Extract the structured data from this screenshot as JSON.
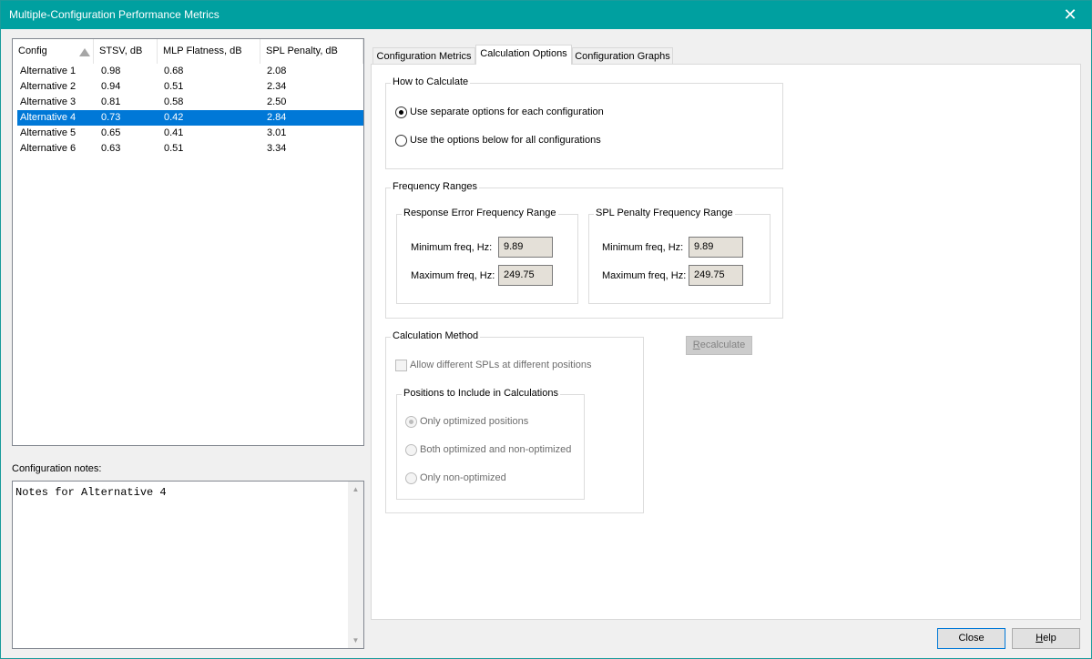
{
  "window": {
    "title": "Multiple-Configuration Performance Metrics",
    "close_glyph": "✕"
  },
  "config_list": {
    "columns": [
      "Config",
      "STSV, dB",
      "MLP Flatness, dB",
      "SPL Penalty, dB"
    ],
    "sort_column": "Config",
    "rows": [
      {
        "config": "Alternative 1",
        "stsv": "0.98",
        "mlp": "0.68",
        "spl": "2.08",
        "selected": false
      },
      {
        "config": "Alternative 2",
        "stsv": "0.94",
        "mlp": "0.51",
        "spl": "2.34",
        "selected": false
      },
      {
        "config": "Alternative 3",
        "stsv": "0.81",
        "mlp": "0.58",
        "spl": "2.50",
        "selected": false
      },
      {
        "config": "Alternative 4",
        "stsv": "0.73",
        "mlp": "0.42",
        "spl": "2.84",
        "selected": true
      },
      {
        "config": "Alternative 5",
        "stsv": "0.65",
        "mlp": "0.41",
        "spl": "3.01",
        "selected": false
      },
      {
        "config": "Alternative 6",
        "stsv": "0.63",
        "mlp": "0.51",
        "spl": "3.34",
        "selected": false
      }
    ]
  },
  "notes": {
    "label": "Configuration notes:",
    "value": "Notes for Alternative 4"
  },
  "tabs": [
    {
      "label": "Configuration Metrics",
      "active": false
    },
    {
      "label": "Calculation Options",
      "active": true
    },
    {
      "label": "Configuration Graphs",
      "active": false
    }
  ],
  "how_to_calculate": {
    "label": "How to Calculate",
    "options": [
      {
        "label": "Use separate options for each configuration",
        "checked": true
      },
      {
        "label": "Use the options below for all configurations",
        "checked": false
      }
    ]
  },
  "frequency_ranges": {
    "label": "Frequency Ranges",
    "response_error": {
      "label": "Response Error Frequency Range",
      "min_label": "Minimum freq, Hz:",
      "min_value": "9.89",
      "max_label": "Maximum freq, Hz:",
      "max_value": "249.75"
    },
    "spl_penalty": {
      "label": "SPL Penalty Frequency Range",
      "min_label": "Minimum freq, Hz:",
      "min_value": "9.89",
      "max_label": "Maximum freq, Hz:",
      "max_value": "249.75"
    }
  },
  "calculation_method": {
    "label": "Calculation Method",
    "allow_different_spls": {
      "label": "Allow different SPLs at different positions",
      "checked": false,
      "enabled": false
    },
    "positions": {
      "label": "Positions to Include in Calculations",
      "options": [
        {
          "label": "Only optimized positions",
          "checked": true
        },
        {
          "label": "Both optimized and non-optimized",
          "checked": false
        },
        {
          "label": "Only non-optimized",
          "checked": false
        }
      ]
    }
  },
  "buttons": {
    "recalculate_first": "R",
    "recalculate_rest": "ecalculate",
    "close": "Close",
    "help_first": "H",
    "help_rest": "elp"
  }
}
